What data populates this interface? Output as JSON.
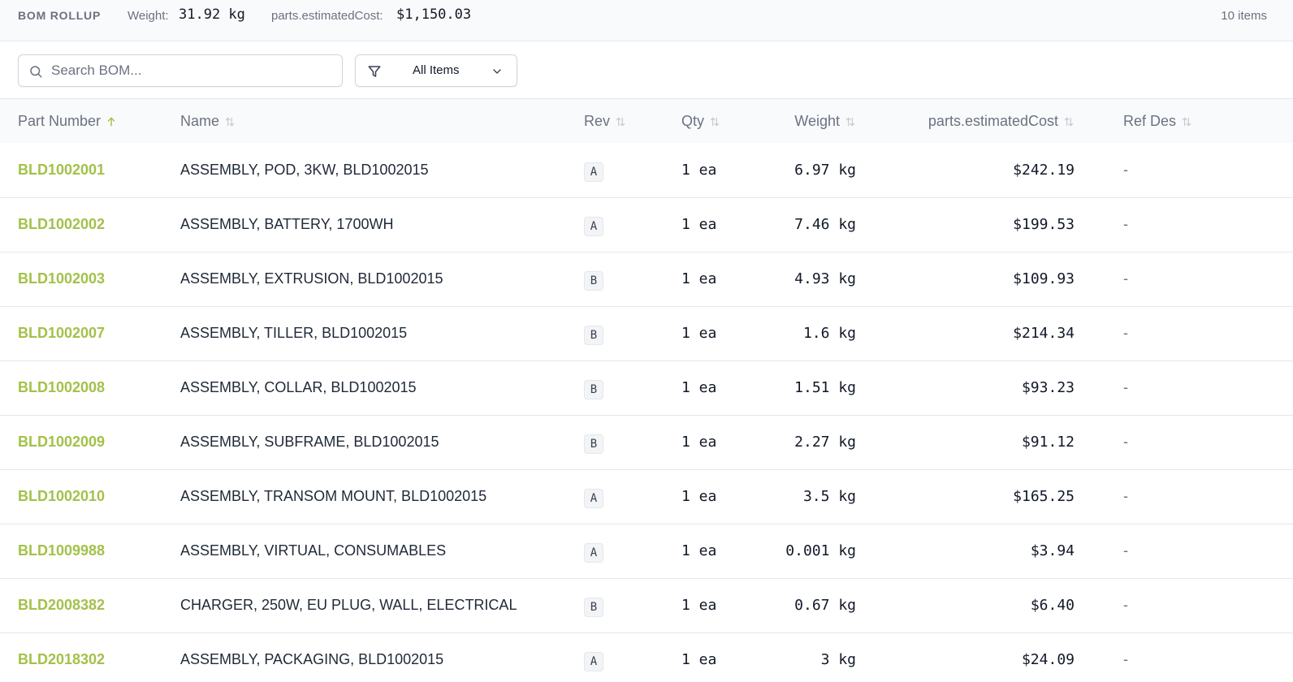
{
  "rollup": {
    "title": "BOM ROLLUP",
    "weight_label": "Weight:",
    "weight_value": "31.92 kg",
    "cost_label": "parts.estimatedCost:",
    "cost_value": "$1,150.03",
    "item_count": "10 items"
  },
  "toolbar": {
    "search_placeholder": "Search BOM...",
    "search_value": "",
    "filter_label": "All Items",
    "icons": {
      "search": "search-icon",
      "filter": "filter-icon",
      "dropdown": "chevron-down-icon"
    }
  },
  "colors": {
    "part_link": "#a3c14a",
    "header_bg": "#f9fafb",
    "border": "#e5e7eb",
    "muted_text": "#6b7280"
  },
  "table": {
    "columns": [
      {
        "label": "Part Number",
        "sort": "asc"
      },
      {
        "label": "Name",
        "sort": "none"
      },
      {
        "label": "Rev",
        "sort": "none"
      },
      {
        "label": "Qty",
        "sort": "none"
      },
      {
        "label": "Weight",
        "sort": "none"
      },
      {
        "label": "parts.estimatedCost",
        "sort": "none"
      },
      {
        "label": "Ref Des",
        "sort": "none"
      }
    ],
    "rows": [
      {
        "part": "BLD1002001",
        "name": "ASSEMBLY, POD, 3KW, BLD1002015",
        "rev": "A",
        "qty": "1 ea",
        "weight": "6.97 kg",
        "cost": "$242.19",
        "refdes": "-"
      },
      {
        "part": "BLD1002002",
        "name": "ASSEMBLY, BATTERY, 1700WH",
        "rev": "A",
        "qty": "1 ea",
        "weight": "7.46 kg",
        "cost": "$199.53",
        "refdes": "-"
      },
      {
        "part": "BLD1002003",
        "name": "ASSEMBLY, EXTRUSION, BLD1002015",
        "rev": "B",
        "qty": "1 ea",
        "weight": "4.93 kg",
        "cost": "$109.93",
        "refdes": "-"
      },
      {
        "part": "BLD1002007",
        "name": "ASSEMBLY, TILLER, BLD1002015",
        "rev": "B",
        "qty": "1 ea",
        "weight": "1.6 kg",
        "cost": "$214.34",
        "refdes": "-"
      },
      {
        "part": "BLD1002008",
        "name": "ASSEMBLY, COLLAR, BLD1002015",
        "rev": "B",
        "qty": "1 ea",
        "weight": "1.51 kg",
        "cost": "$93.23",
        "refdes": "-"
      },
      {
        "part": "BLD1002009",
        "name": "ASSEMBLY, SUBFRAME, BLD1002015",
        "rev": "B",
        "qty": "1 ea",
        "weight": "2.27 kg",
        "cost": "$91.12",
        "refdes": "-"
      },
      {
        "part": "BLD1002010",
        "name": "ASSEMBLY, TRANSOM MOUNT, BLD1002015",
        "rev": "A",
        "qty": "1 ea",
        "weight": "3.5 kg",
        "cost": "$165.25",
        "refdes": "-"
      },
      {
        "part": "BLD1009988",
        "name": "ASSEMBLY, VIRTUAL, CONSUMABLES",
        "rev": "A",
        "qty": "1 ea",
        "weight": "0.001 kg",
        "cost": "$3.94",
        "refdes": "-"
      },
      {
        "part": "BLD2008382",
        "name": "CHARGER, 250W, EU PLUG, WALL, ELECTRICAL",
        "rev": "B",
        "qty": "1 ea",
        "weight": "0.67 kg",
        "cost": "$6.40",
        "refdes": "-"
      },
      {
        "part": "BLD2018302",
        "name": "ASSEMBLY, PACKAGING, BLD1002015",
        "rev": "A",
        "qty": "1 ea",
        "weight": "3 kg",
        "cost": "$24.09",
        "refdes": "-"
      }
    ]
  }
}
